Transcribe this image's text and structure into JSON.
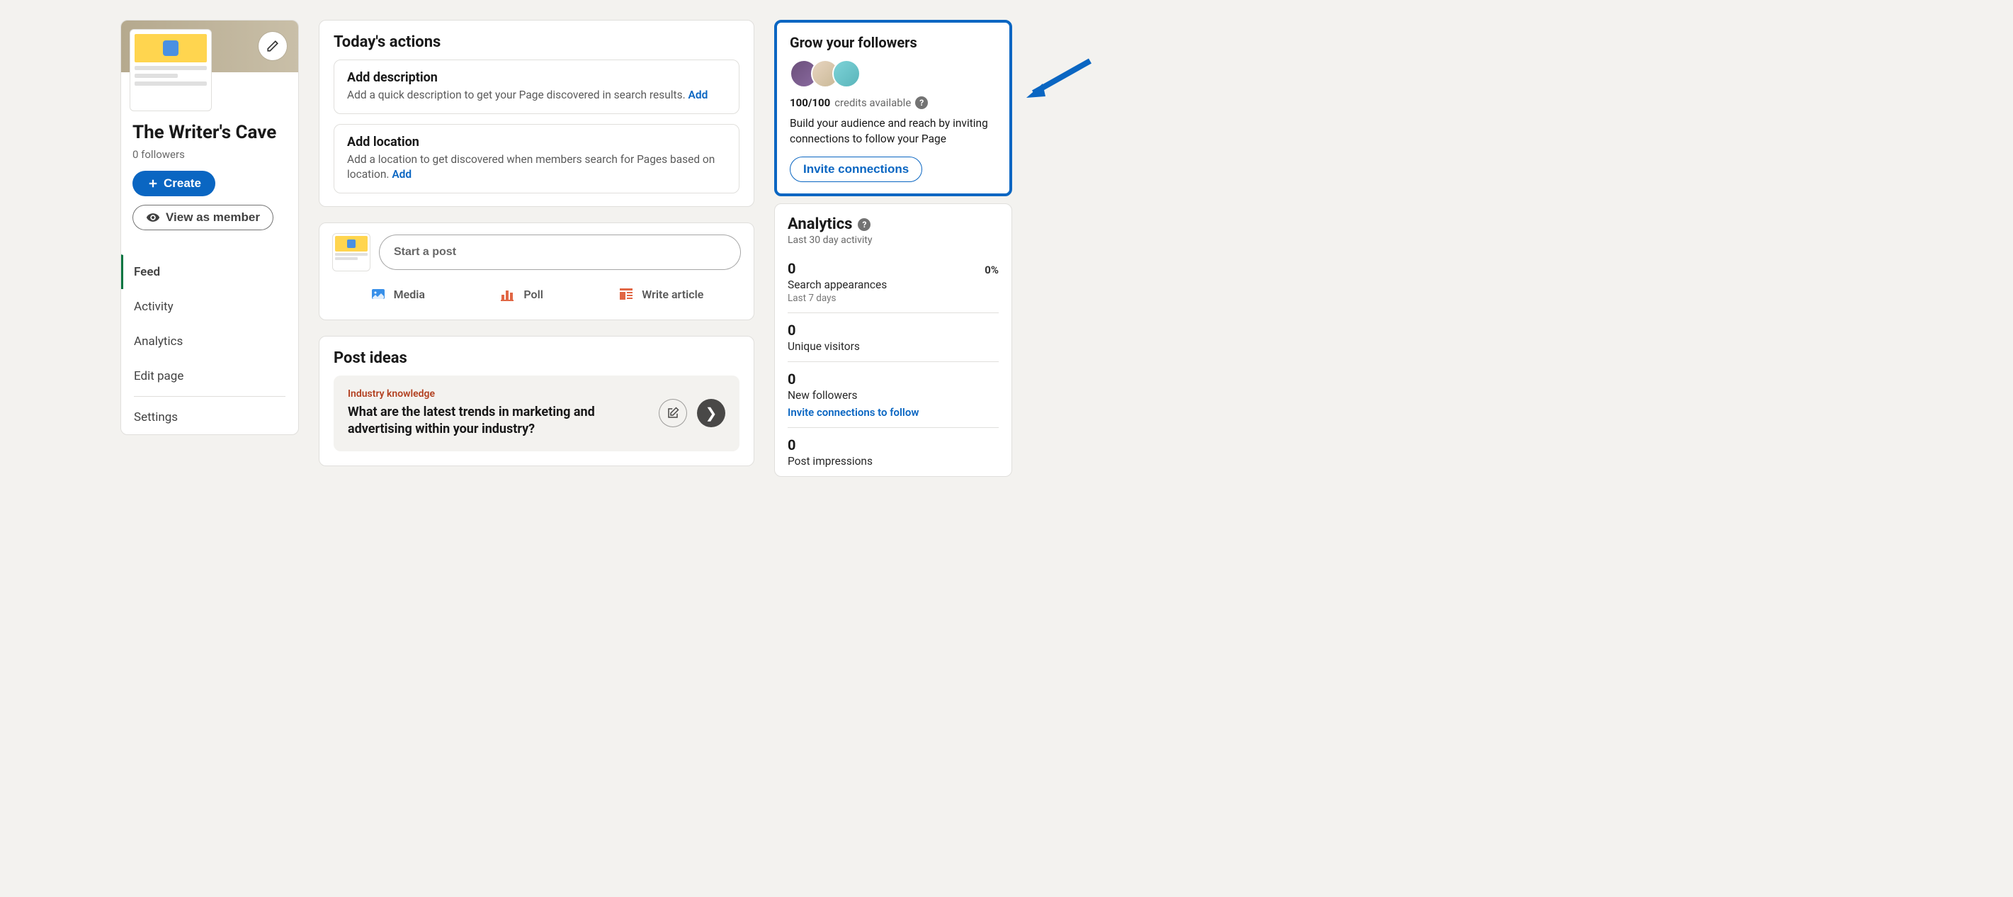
{
  "sidebar": {
    "page_name": "The Writer's Cave",
    "followers": "0 followers",
    "create_label": "Create",
    "view_member_label": "View as member",
    "nav": {
      "feed": "Feed",
      "activity": "Activity",
      "analytics": "Analytics",
      "edit_page": "Edit page",
      "settings": "Settings"
    }
  },
  "todays_actions": {
    "title": "Today's actions",
    "items": [
      {
        "title": "Add description",
        "desc": "Add a quick description to get your Page discovered in search results. ",
        "link": "Add"
      },
      {
        "title": "Add location",
        "desc": "Add a location to get discovered when members search for Pages based on location. ",
        "link": "Add"
      }
    ]
  },
  "start_post": {
    "placeholder": "Start a post",
    "media": "Media",
    "poll": "Poll",
    "article": "Write article"
  },
  "post_ideas": {
    "title": "Post ideas",
    "category": "Industry knowledge",
    "question": "What are the latest trends in marketing and advertising within your industry?"
  },
  "grow": {
    "title": "Grow your followers",
    "credits_bold": "100/100",
    "credits_text": "credits available",
    "desc": "Build your audience and reach by inviting connections to follow your Page",
    "button": "Invite connections"
  },
  "analytics": {
    "title": "Analytics",
    "subtitle": "Last 30 day activity",
    "stats": [
      {
        "value": "0",
        "pct": "0%",
        "label": "Search appearances",
        "sub": "Last 7 days"
      },
      {
        "value": "0",
        "label": "Unique visitors"
      },
      {
        "value": "0",
        "label": "New followers",
        "link": "Invite connections to follow"
      },
      {
        "value": "0",
        "label": "Post impressions"
      }
    ]
  }
}
